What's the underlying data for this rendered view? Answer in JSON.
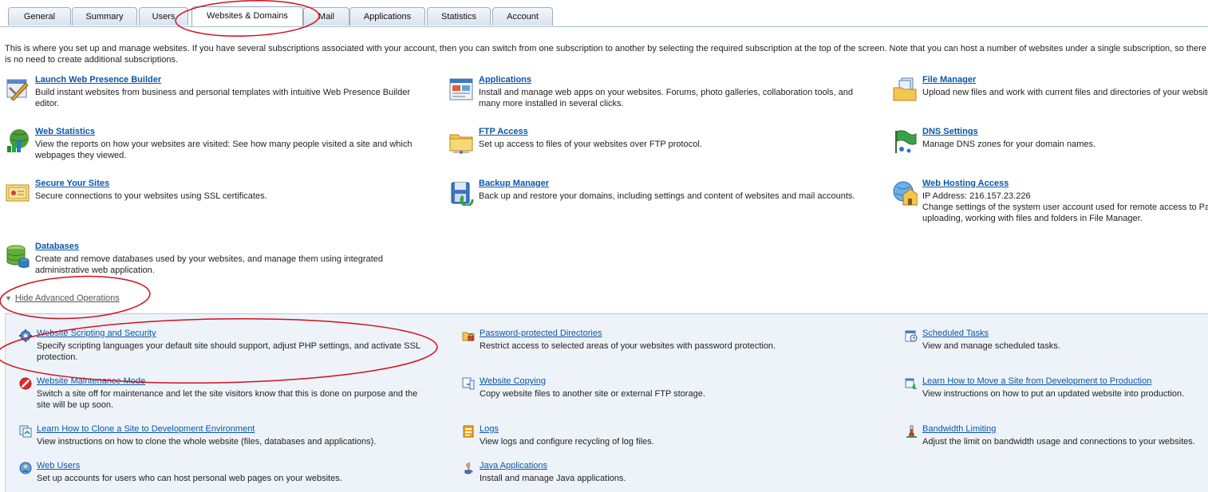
{
  "tabs": [
    "General",
    "Summary",
    "Users",
    "Websites & Domains",
    "Mail",
    "Applications",
    "Statistics",
    "Account"
  ],
  "active_tab": "Websites & Domains",
  "intro": "This is where you set up and manage websites. If you have several subscriptions associated with your account, then you can switch from one subscription to another by selecting the required subscription at the top of the screen. Note that you can host a number of websites under a single subscription, so there is no need to create additional subscriptions.",
  "tools": {
    "launch_builder": {
      "title": "Launch Web Presence Builder",
      "desc": "Build instant websites from business and personal templates with intuitive Web Presence Builder editor.",
      "icon": "builder-icon"
    },
    "applications": {
      "title": "Applications",
      "desc": "Install and manage web apps on your websites. Forums, photo galleries, collaboration tools, and many more installed in several clicks.",
      "icon": "applications-icon"
    },
    "file_manager": {
      "title": "File Manager",
      "desc": "Upload new files and work with current files and directories of your websites.",
      "icon": "file-manager-icon"
    },
    "web_statistics": {
      "title": "Web Statistics",
      "desc": "View the reports on how your websites are visited: See how many people visited a site and which webpages they viewed.",
      "icon": "web-statistics-icon"
    },
    "ftp_access": {
      "title": "FTP Access",
      "desc": "Set up access to files of your websites over FTP protocol.",
      "icon": "ftp-folder-icon"
    },
    "dns_settings": {
      "title": "DNS Settings",
      "desc": "Manage DNS zones for your domain names.",
      "icon": "dns-flag-icon"
    },
    "secure_sites": {
      "title": "Secure Your Sites",
      "desc": "Secure connections to your websites using SSL certificates.",
      "icon": "ssl-certificate-icon"
    },
    "backup_manager": {
      "title": "Backup Manager",
      "desc": "Back up and restore your domains, including settings and content of websites and mail accounts.",
      "icon": "backup-icon"
    },
    "hosting_access": {
      "title": "Web Hosting Access",
      "ip": "IP Address: 216.157.23.226",
      "desc": "Change settings of the system user account used for remote access to Panel when uploading, working with files and folders in File Manager.",
      "icon": "hosting-house-icon"
    },
    "databases": {
      "title": "Databases",
      "desc": "Create and remove databases used by your websites, and manage them using integrated administrative web application.",
      "icon": "database-icon"
    }
  },
  "advanced_toggle": "Hide Advanced Operations",
  "advanced": {
    "scripting": {
      "title": "Website Scripting and Security",
      "desc": "Specify scripting languages your default site should support, adjust PHP settings, and activate SSL protection.",
      "icon": "scripting-gear-icon"
    },
    "password_dirs": {
      "title": "Password-protected Directories",
      "desc": "Restrict access to selected areas of your websites with password protection.",
      "icon": "lock-folder-icon"
    },
    "scheduled_tasks": {
      "title": "Scheduled Tasks",
      "desc": "View and manage scheduled tasks.",
      "icon": "scheduled-tasks-icon"
    },
    "maintenance": {
      "title": "Website Maintenance Mode",
      "desc": "Switch a site off for maintenance and let the site visitors know that this is done on purpose and the site will be up soon.",
      "icon": "no-entry-icon"
    },
    "copying": {
      "title": "Website Copying",
      "desc": "Copy website files to another site or external FTP storage.",
      "icon": "copy-icon"
    },
    "move_site": {
      "title": "Learn How to Move a Site from Development to Production",
      "desc": "View instructions on how to put an updated website into production.",
      "icon": "move-site-icon"
    },
    "clone_site": {
      "title": "Learn How to Clone a Site to Development Environment",
      "desc": "View instructions on how to clone the whole website (files, databases and applications).",
      "icon": "clone-site-icon"
    },
    "logs": {
      "title": "Logs",
      "desc": "View logs and configure recycling of log files.",
      "icon": "logs-icon"
    },
    "bandwidth": {
      "title": "Bandwidth Limiting",
      "desc": "Adjust the limit on bandwidth usage and connections to your websites.",
      "icon": "bandwidth-icon"
    },
    "web_users": {
      "title": "Web Users",
      "desc": "Set up accounts for users who can host personal web pages on your websites.",
      "icon": "web-users-icon"
    },
    "java_apps": {
      "title": "Java Applications",
      "desc": "Install and manage Java applications.",
      "icon": "java-icon"
    }
  },
  "colors": {
    "link": "#0a56a8",
    "annotation": "#d0101e",
    "panel": "#eef3f9"
  }
}
